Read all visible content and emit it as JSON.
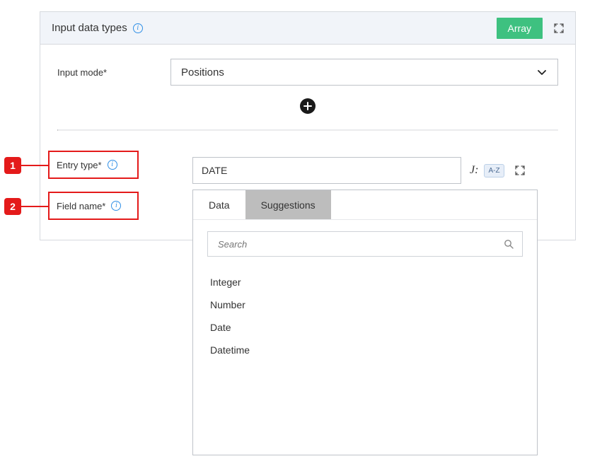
{
  "header": {
    "title": "Input data types",
    "array_button": "Array"
  },
  "form": {
    "input_mode_label": "Input mode*",
    "input_mode_value": "Positions"
  },
  "callouts": {
    "one": "1",
    "two": "2",
    "entry_type_label": "Entry type*",
    "field_name_label": "Field name*"
  },
  "entry": {
    "value": "DATE",
    "j_label": "J:",
    "az_badge": "A-Z"
  },
  "dropdown": {
    "tabs": [
      "Data",
      "Suggestions"
    ],
    "search_placeholder": "Search",
    "options": [
      "Integer",
      "Number",
      "Date",
      "Datetime"
    ]
  }
}
